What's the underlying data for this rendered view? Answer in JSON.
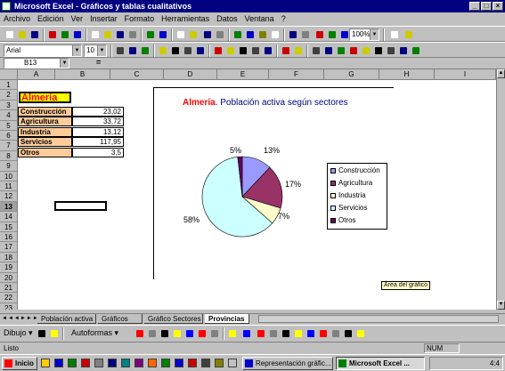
{
  "window": {
    "title": "Microsoft Excel - Gráficos y tablas cualitativos"
  },
  "menu": [
    "Archivo",
    "Edición",
    "Ver",
    "Insertar",
    "Formato",
    "Herramientas",
    "Datos",
    "Ventana",
    "?"
  ],
  "format_bar": {
    "font": "Arial",
    "size": "10",
    "zoom": "100%"
  },
  "formula_bar": {
    "name_box": "B13",
    "content": "="
  },
  "columns": [
    "A",
    "B",
    "C",
    "D",
    "E",
    "F",
    "G",
    "H",
    "I"
  ],
  "rows": [
    "1",
    "2",
    "3",
    "4",
    "5",
    "6",
    "7",
    "8",
    "9",
    "10",
    "11",
    "12",
    "13",
    "14",
    "15",
    "16",
    "17",
    "18",
    "19",
    "20",
    "21",
    "22",
    "23"
  ],
  "table": {
    "title": "Almeria",
    "rows": [
      {
        "label": "Construcción",
        "value": "23,02"
      },
      {
        "label": "Agricultura",
        "value": "33,72"
      },
      {
        "label": "Industria",
        "value": "13,12"
      },
      {
        "label": "Servicios",
        "value": "117,95"
      },
      {
        "label": "Otros",
        "value": "3,5"
      }
    ]
  },
  "chart_data": {
    "type": "pie",
    "title": "Almería",
    "subtitle": ". Población activa según sectores",
    "categories": [
      "Construcción",
      "Agricultura",
      "Industria",
      "Servicios",
      "Otros"
    ],
    "values": [
      23.02,
      33.72,
      13.12,
      117.95,
      3.5
    ],
    "data_labels": [
      "13%",
      "17%",
      "7%",
      "58%",
      "5%"
    ],
    "colors": [
      "#9999ff",
      "#993366",
      "#ffffcc",
      "#ccffff",
      "#660066"
    ],
    "legend_position": "right"
  },
  "chart_tooltip": "Área del gráfico",
  "sheet_tabs": [
    "Población activa",
    "Gráficos",
    "Gráfico Sectores",
    "Provincias"
  ],
  "active_tab": "Provincias",
  "drawing_bar": {
    "draw": "Dibujo",
    "autoshapes": "Autoformas"
  },
  "status": {
    "left": "Listo",
    "num": "NUM"
  },
  "taskbar": {
    "start": "Inicio",
    "items": [
      "Representación gráfic...",
      "Microsoft Excel ..."
    ],
    "clock": "4:4"
  }
}
